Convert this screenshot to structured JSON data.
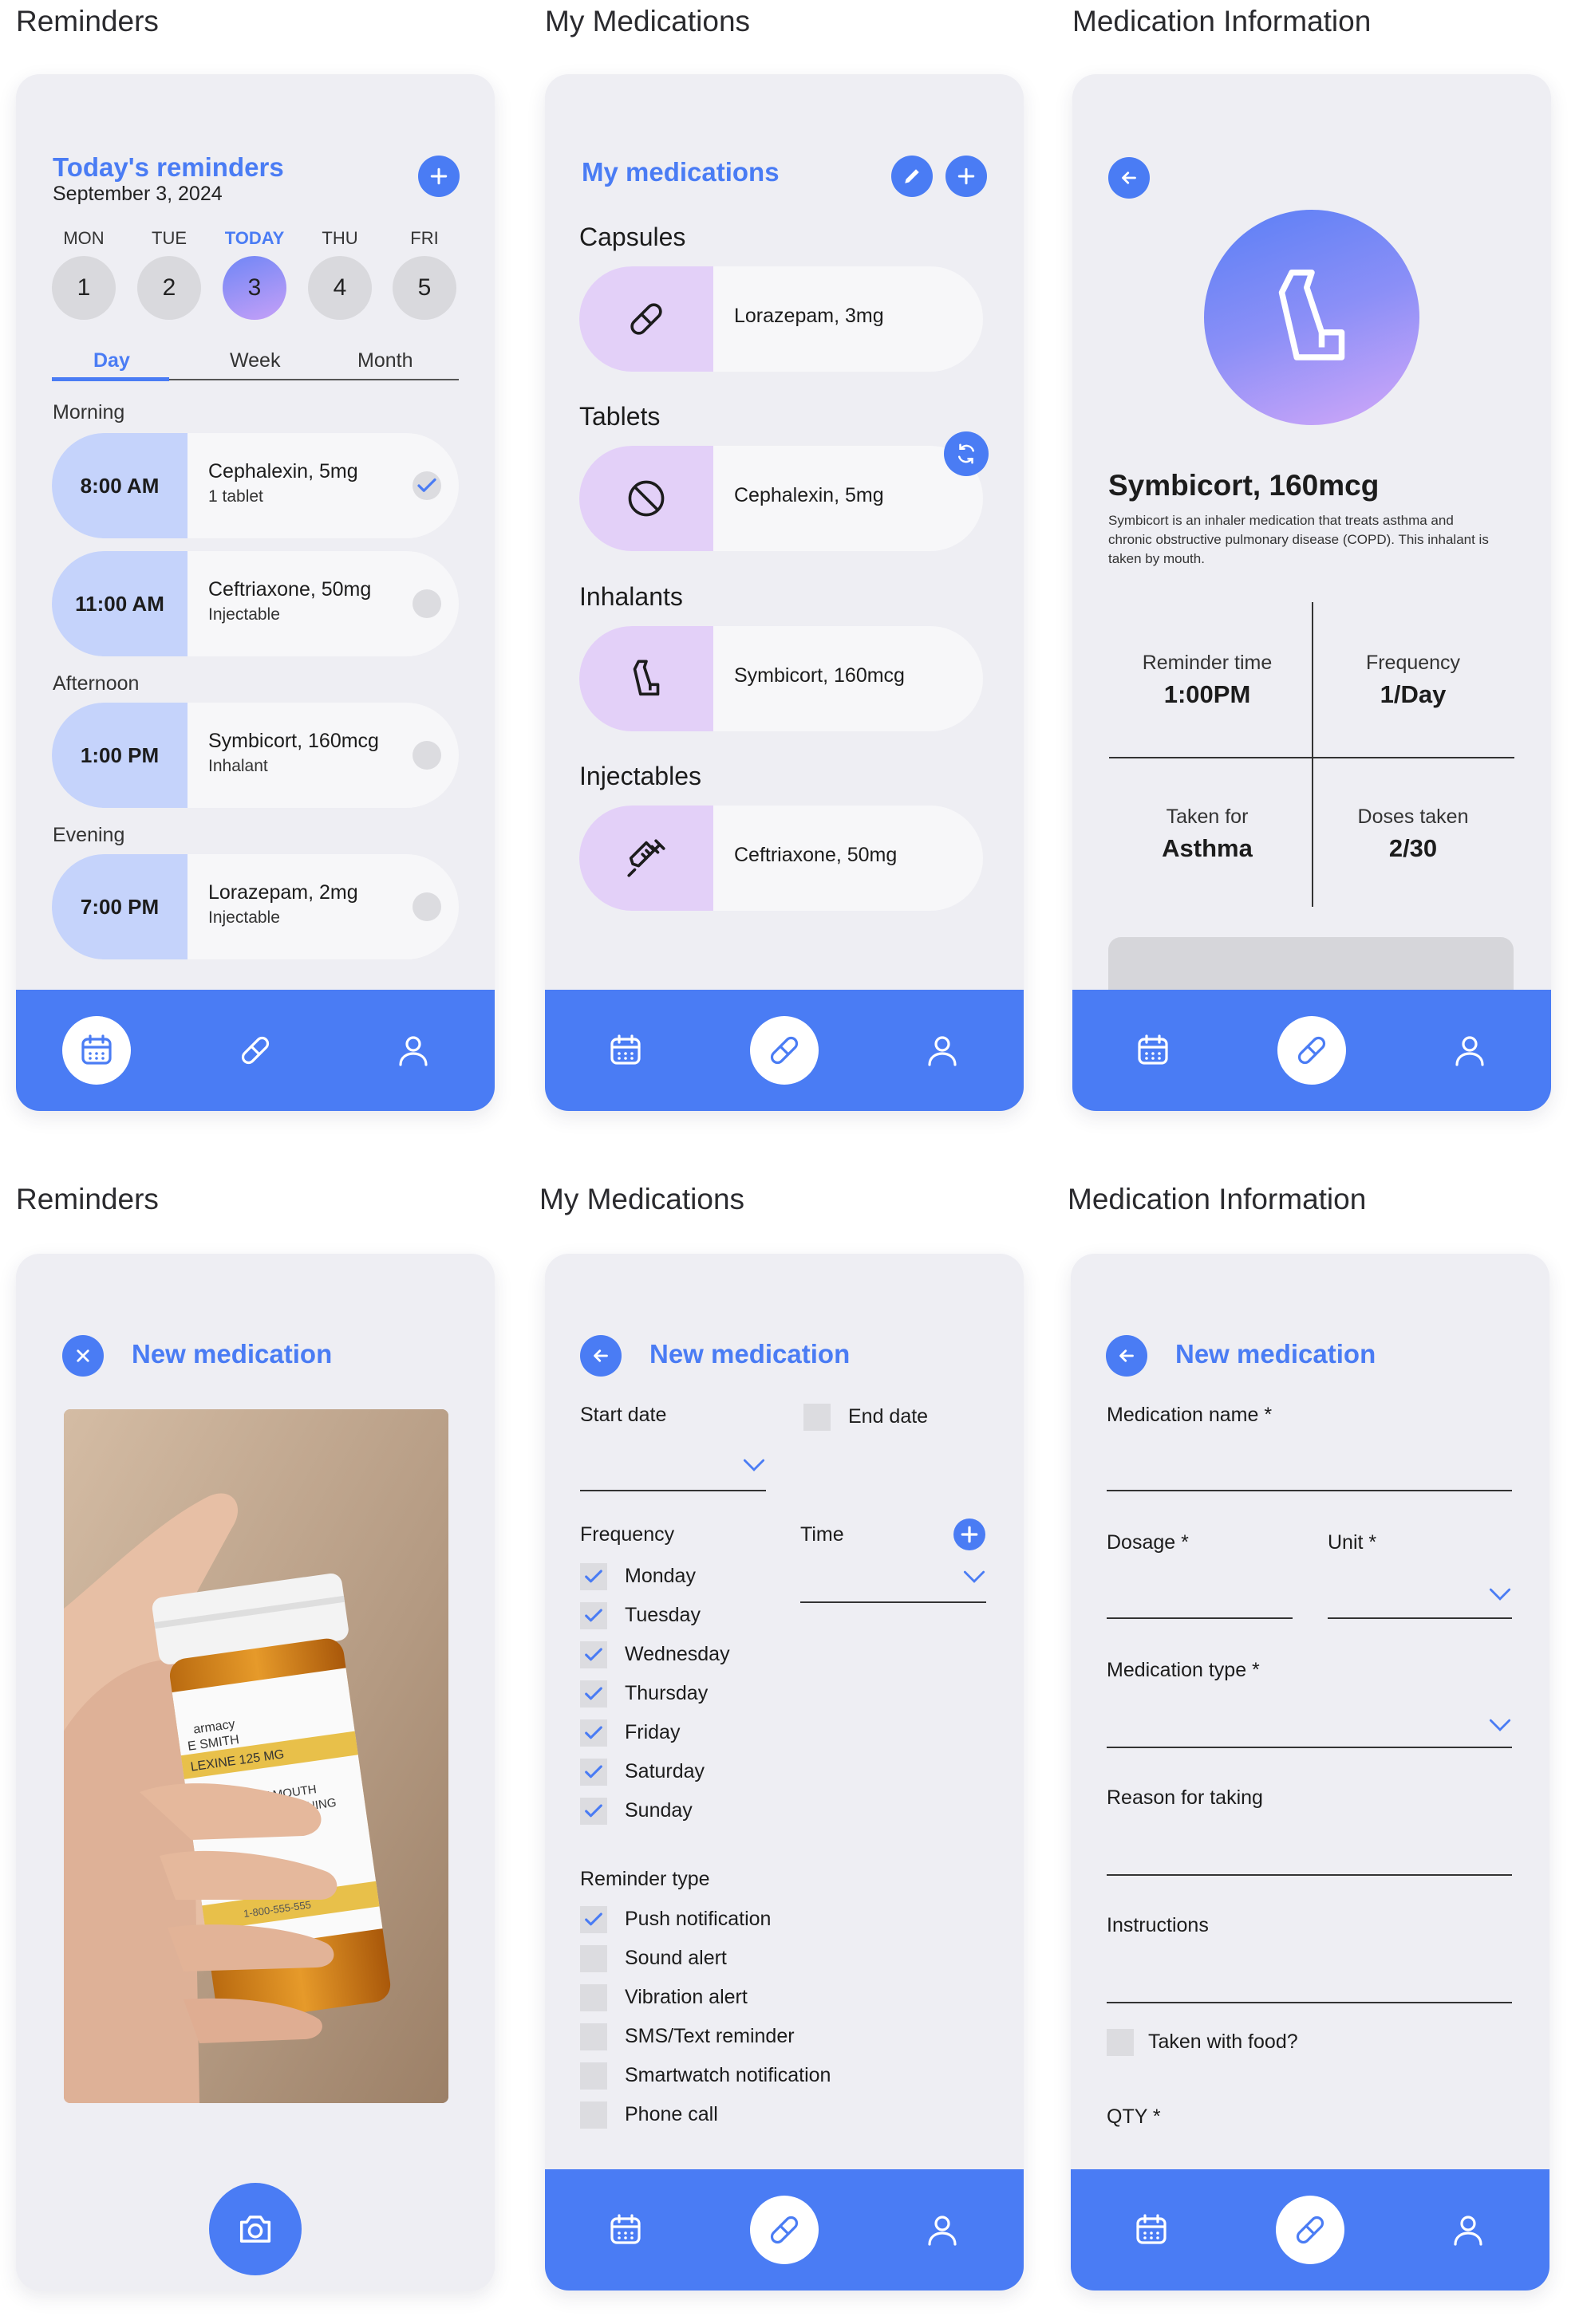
{
  "sections": {
    "top_left": "Reminders",
    "top_mid": "My Medications",
    "top_right": "Medication Information",
    "bottom_left": "Reminders",
    "bottom_mid": "My Medications",
    "bottom_right": "Medication Information"
  },
  "colors": {
    "accent": "#4a7cf4",
    "card_time_bg": "#c5d3fb",
    "med_icon_bg": "#e3d0f8",
    "screen_bg": "#eeeef3"
  },
  "reminders": {
    "title": "Today's reminders",
    "date": "September 3, 2024",
    "days": [
      {
        "name": "MON",
        "num": "1"
      },
      {
        "name": "TUE",
        "num": "2"
      },
      {
        "name": "TODAY",
        "num": "3"
      },
      {
        "name": "THU",
        "num": "4"
      },
      {
        "name": "FRI",
        "num": "5"
      }
    ],
    "tabs": [
      "Day",
      "Week",
      "Month"
    ],
    "groups": {
      "morning": "Morning",
      "afternoon": "Afternoon",
      "evening": "Evening"
    },
    "items": [
      {
        "time": "8:00 AM",
        "name": "Cephalexin, 5mg",
        "sub": "1 tablet",
        "done": true
      },
      {
        "time": "11:00 AM",
        "name": "Ceftriaxone, 50mg",
        "sub": "Injectable",
        "done": false
      },
      {
        "time": "1:00 PM",
        "name": "Symbicort, 160mcg",
        "sub": "Inhalant",
        "done": false
      },
      {
        "time": "7:00 PM",
        "name": "Lorazepam, 2mg",
        "sub": "Injectable",
        "done": false
      }
    ]
  },
  "medications": {
    "title": "My medications",
    "categories": [
      {
        "label": "Capsules",
        "item": "Lorazepam, 3mg",
        "icon": "capsule-icon"
      },
      {
        "label": "Tablets",
        "item": "Cephalexin, 5mg",
        "icon": "tablet-icon"
      },
      {
        "label": "Inhalants",
        "item": "Symbicort, 160mcg",
        "icon": "inhaler-icon"
      },
      {
        "label": "Injectables",
        "item": "Ceftriaxone, 50mg",
        "icon": "syringe-icon"
      }
    ]
  },
  "info": {
    "name": "Symbicort, 160mcg",
    "description": "Symbicort is an inhaler medication that treats asthma and chronic obstructive pulmonary disease (COPD). This inhalant is taken by mouth.",
    "reminder_time_label": "Reminder time",
    "reminder_time": "1:00PM",
    "frequency_label": "Frequency",
    "frequency": "1/Day",
    "taken_for_label": "Taken for",
    "taken_for": "Asthma",
    "doses_label": "Doses taken",
    "doses": "2/30"
  },
  "new_med": {
    "title": "New medication",
    "start_date": "Start date",
    "end_date": "End date",
    "frequency": "Frequency",
    "time": "Time",
    "days": [
      "Monday",
      "Tuesday",
      "Wednesday",
      "Thursday",
      "Friday",
      "Saturday",
      "Sunday"
    ],
    "reminder_type": "Reminder type",
    "reminder_options": [
      {
        "label": "Push notification",
        "checked": true
      },
      {
        "label": "Sound alert",
        "checked": false
      },
      {
        "label": "Vibration alert",
        "checked": false
      },
      {
        "label": "SMS/Text reminder",
        "checked": false
      },
      {
        "label": "Smartwatch notification",
        "checked": false
      },
      {
        "label": "Phone call",
        "checked": false
      }
    ],
    "medication_name": "Medication name *",
    "dosage": "Dosage *",
    "unit": "Unit *",
    "medication_type": "Medication type *",
    "reason": "Reason for taking",
    "instructions": "Instructions",
    "taken_with_food": "Taken with food?",
    "qty": "QTY *"
  },
  "photo_label": {
    "line1": "armacy",
    "line2": "E SMITH",
    "line3": "LEXINE 125 MG",
    "line4": "E TABLET BY MOUTH",
    "line5": "FOOD EVERY MORNING",
    "line6": "1-800-555-555"
  }
}
